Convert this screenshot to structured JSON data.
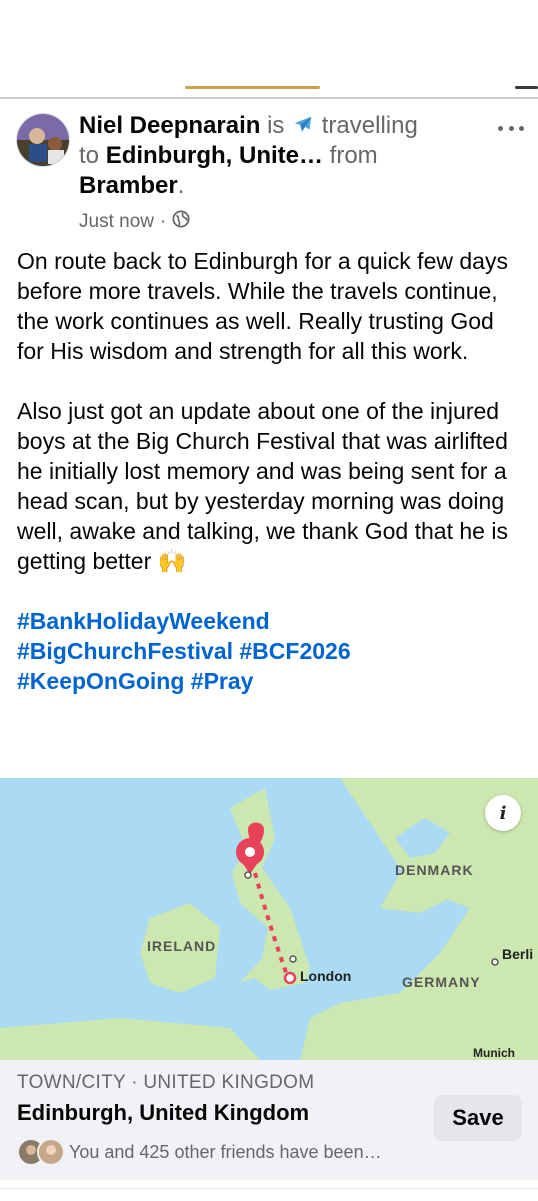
{
  "post": {
    "author": "Niel Deepnarain",
    "is_text": " is ",
    "activity_icon": "airplane-icon",
    "activity": "travelling",
    "to_text": "to ",
    "destination": "Edinburgh, Unite…",
    "from_text": " from",
    "origin": "Bramber",
    "period": ".",
    "timestamp": "Just now",
    "dot": "·",
    "privacy_icon": "globe-icon",
    "paragraph_1": "On route back to Edinburgh for a quick few days before more travels. While the travels continue, the work continues as well. Really trusting God for His wisdom and strength for all this work.",
    "paragraph_2": "Also just got an update about one of the injured boys at the Big Church Festival that was airlifted he initially lost memory and was being sent for a head scan, but by yesterday morning was doing well, awake and talking, we thank God that he is getting better 🙌",
    "hashtags": [
      "#BankHolidayWeekend",
      "#BigChurchFestival",
      "#BCF2026",
      "#KeepOnGoing",
      "#Pray"
    ]
  },
  "map": {
    "labels": {
      "denmark": "DENMARK",
      "ireland": "IRELAND",
      "germany": "GERMANY",
      "london": "London",
      "berlin": "Berli",
      "munich": "Munich"
    },
    "info_icon": "info-icon",
    "info_label": "i"
  },
  "place": {
    "type": "TOWN/CITY · UNITED KINGDOM",
    "name": "Edinburgh, United Kingdom",
    "friends_text": "You and 425 other friends have been…",
    "save_label": "Save"
  },
  "colors": {
    "hashtag": "#0064d1",
    "pin": "#e8415a",
    "water": "#aadaf4",
    "land": "#cde7b0",
    "card_bg": "#f0f2f5",
    "secondary_text": "#65676b"
  }
}
